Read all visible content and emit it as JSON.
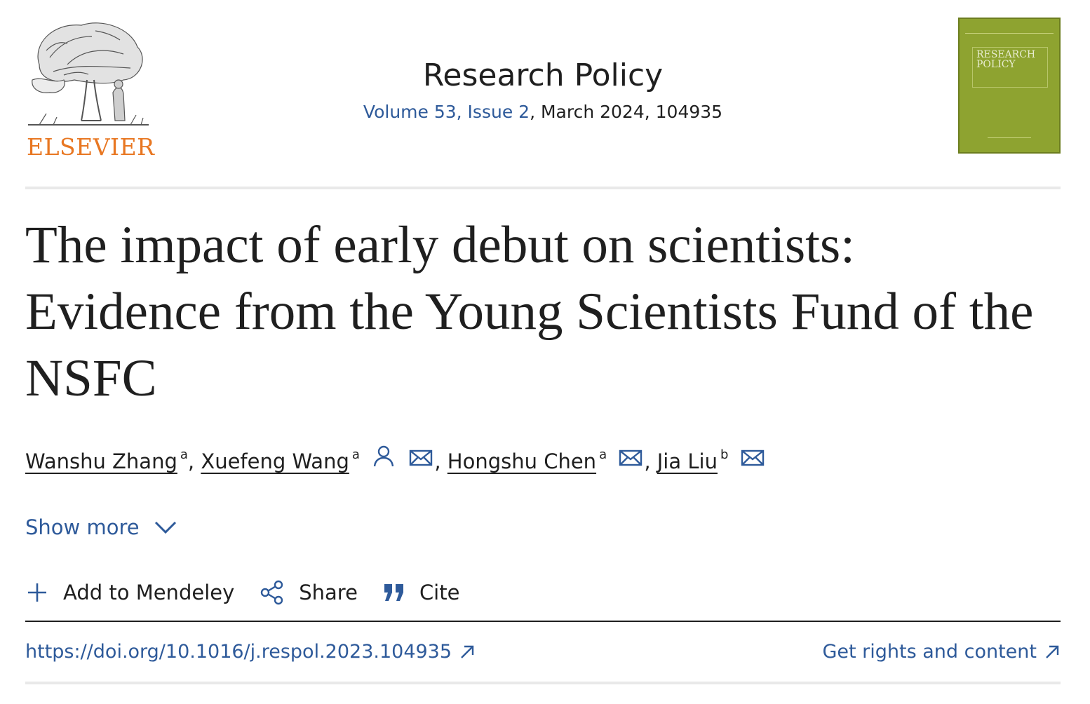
{
  "publisher": {
    "name": "ELSEVIER",
    "logo_icon": "elsevier-tree-icon",
    "brand_color": "#e87722"
  },
  "journal": {
    "title": "Research Policy",
    "volume_issue": "Volume 53, Issue 2",
    "date_id": ", March 2024, 104935",
    "cover": {
      "title_line1": "RESEARCH",
      "title_line2": "POLICY",
      "color": "#8ea330"
    }
  },
  "article": {
    "title": "The impact of early debut on scientists: Evidence from the Young Scientists Fund of the NSFC",
    "authors": [
      {
        "name": "Wanshu Zhang",
        "affiliation": "a",
        "icons": []
      },
      {
        "name": "Xuefeng Wang",
        "affiliation": "a",
        "icons": [
          "person-icon",
          "mail-icon"
        ]
      },
      {
        "name": "Hongshu Chen",
        "affiliation": "a",
        "icons": [
          "mail-icon"
        ]
      },
      {
        "name": "Jia Liu",
        "affiliation": "b",
        "icons": [
          "mail-icon"
        ]
      }
    ],
    "separator": ","
  },
  "show_more": {
    "label": "Show more"
  },
  "actions": {
    "mendeley": "Add to Mendeley",
    "share": "Share",
    "cite": "Cite"
  },
  "links": {
    "doi": "https://doi.org/10.1016/j.respol.2023.104935",
    "rights": "Get rights and content"
  },
  "colors": {
    "link": "#2e5a9a",
    "text": "#1f1f1f"
  }
}
